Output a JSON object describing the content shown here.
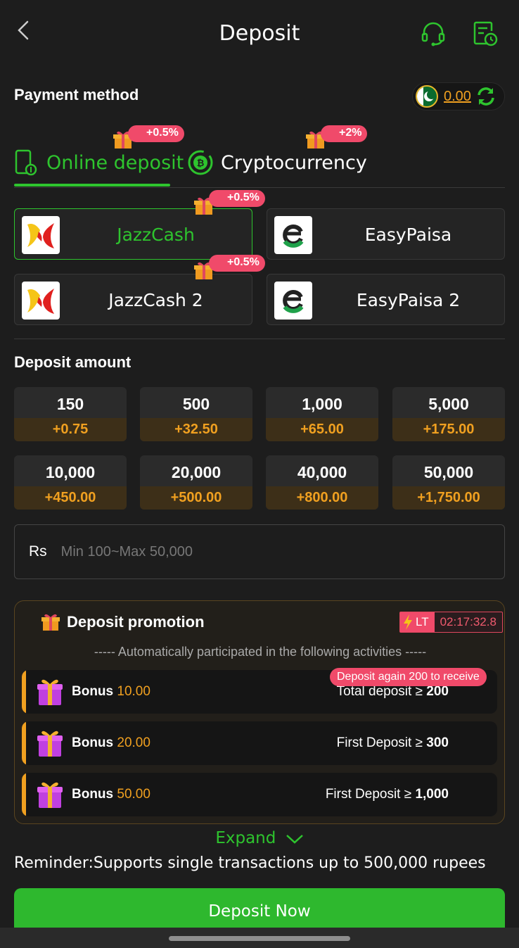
{
  "header": {
    "title": "Deposit",
    "back_icon": "chevron-left-icon",
    "support_icon": "headset-icon",
    "history_icon": "document-clock-icon"
  },
  "payment": {
    "label": "Payment method",
    "balance": "0.00",
    "flag": "pakistan-flag-icon"
  },
  "tabs": [
    {
      "label": "Online deposit",
      "badge": "+0.5%",
      "active": true
    },
    {
      "label": "Cryptocurrency",
      "badge": "+2%",
      "active": false
    }
  ],
  "methods": [
    {
      "label": "JazzCash",
      "badge": "+0.5%",
      "active": true
    },
    {
      "label": "EasyPaisa",
      "badge": "",
      "active": false
    },
    {
      "label": "JazzCash 2",
      "badge": "+0.5%",
      "active": false
    },
    {
      "label": "EasyPaisa 2",
      "badge": "",
      "active": false
    }
  ],
  "deposit_amount": {
    "label": "Deposit amount",
    "options": [
      {
        "value": "150",
        "bonus": "+0.75"
      },
      {
        "value": "500",
        "bonus": "+32.50"
      },
      {
        "value": "1,000",
        "bonus": "+65.00"
      },
      {
        "value": "5,000",
        "bonus": "+175.00"
      },
      {
        "value": "10,000",
        "bonus": "+450.00"
      },
      {
        "value": "20,000",
        "bonus": "+500.00"
      },
      {
        "value": "40,000",
        "bonus": "+800.00"
      },
      {
        "value": "50,000",
        "bonus": "+1,750.00"
      }
    ],
    "currency": "Rs",
    "placeholder": "Min 100~Max 50,000"
  },
  "promotion": {
    "title": "Deposit promotion",
    "timer_tag": "LT",
    "timer": "02:17:32.8",
    "subtitle": "----- Automatically participated in the following activities -----",
    "again_badge": "Deposit again 200 to receive",
    "items": [
      {
        "label": "Bonus",
        "amount": "10.00",
        "cond": "Total deposit ≥ ",
        "cond_val": "200"
      },
      {
        "label": "Bonus",
        "amount": "20.00",
        "cond": "First Deposit ≥ ",
        "cond_val": "300"
      },
      {
        "label": "Bonus",
        "amount": "50.00",
        "cond": "First Deposit ≥ ",
        "cond_val": "1,000"
      }
    ]
  },
  "expand_label": "Expand",
  "reminder": "Reminder:Supports single transactions up to 500,000 rupees",
  "deposit_button": "Deposit Now",
  "colors": {
    "accent_green": "#2ec42e",
    "bonus_orange": "#f0a020",
    "badge_pink": "#f04a6a",
    "background": "#1d1d1d"
  }
}
